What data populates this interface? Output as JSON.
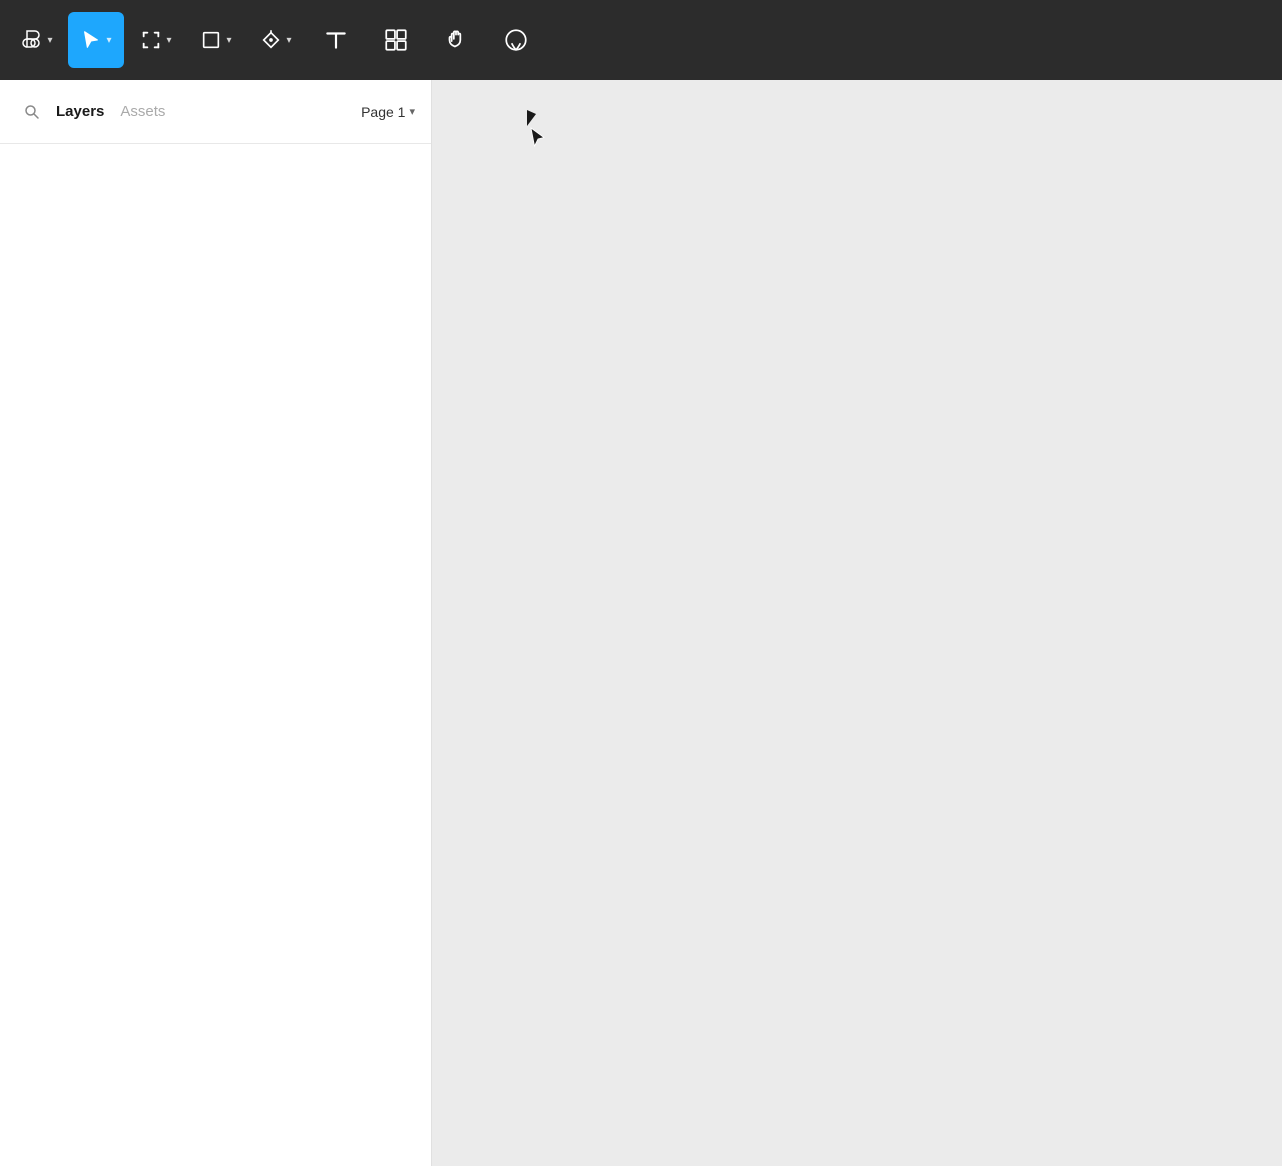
{
  "toolbar": {
    "tools": [
      {
        "id": "logo",
        "label": "Figma",
        "active": false,
        "has_chevron": true
      },
      {
        "id": "select",
        "label": "Select",
        "active": true,
        "has_chevron": true
      },
      {
        "id": "frame",
        "label": "Frame",
        "active": false,
        "has_chevron": true
      },
      {
        "id": "shape",
        "label": "Shape",
        "active": false,
        "has_chevron": true
      },
      {
        "id": "pen",
        "label": "Pen",
        "active": false,
        "has_chevron": true
      },
      {
        "id": "text",
        "label": "Text",
        "active": false,
        "has_chevron": false
      },
      {
        "id": "components",
        "label": "Components",
        "active": false,
        "has_chevron": false
      },
      {
        "id": "hand",
        "label": "Hand",
        "active": false,
        "has_chevron": false
      },
      {
        "id": "comment",
        "label": "Comment",
        "active": false,
        "has_chevron": false
      }
    ]
  },
  "left_panel": {
    "tabs": [
      {
        "id": "layers",
        "label": "Layers",
        "active": true
      },
      {
        "id": "assets",
        "label": "Assets",
        "active": false
      }
    ],
    "page_selector": {
      "label": "Page 1",
      "chevron": "▾"
    },
    "search_placeholder": "Search layers"
  },
  "canvas": {
    "background_color": "#ebebeb"
  },
  "colors": {
    "toolbar_bg": "#2c2c2c",
    "active_tool": "#1ea7fd",
    "panel_bg": "#ffffff",
    "canvas_bg": "#ebebeb"
  }
}
